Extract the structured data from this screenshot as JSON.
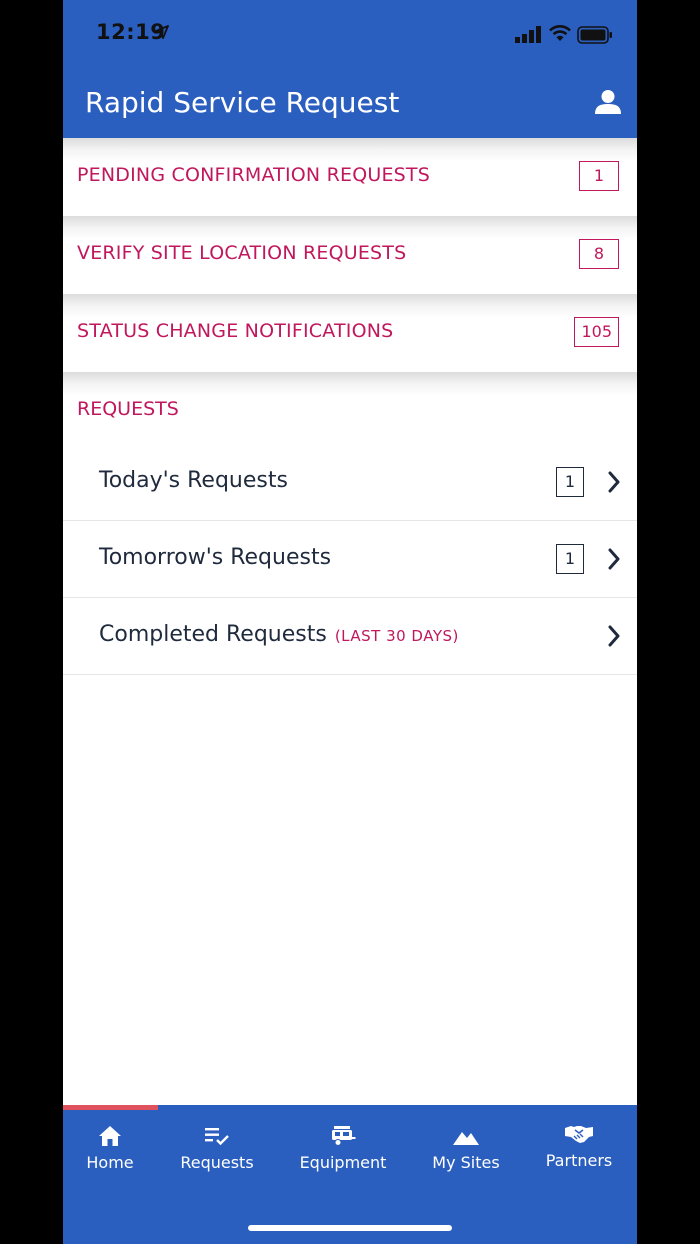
{
  "status_bar": {
    "time": "12:19"
  },
  "header": {
    "title": "Rapid Service Request"
  },
  "alerts": [
    {
      "label": "PENDING CONFIRMATION REQUESTS",
      "count": "1"
    },
    {
      "label": "VERIFY SITE LOCATION REQUESTS",
      "count": "8"
    },
    {
      "label": "STATUS CHANGE NOTIFICATIONS",
      "count": "105"
    }
  ],
  "requests_section": {
    "title": "REQUESTS",
    "items": [
      {
        "label": "Today's Requests",
        "count": "1"
      },
      {
        "label": "Tomorrow's Requests",
        "count": "1"
      },
      {
        "label": "Completed Requests",
        "sub": "(LAST 30 DAYS)"
      }
    ]
  },
  "tabs": [
    {
      "label": "Home",
      "icon": "home-icon",
      "active": true
    },
    {
      "label": "Requests",
      "icon": "requests-list-icon"
    },
    {
      "label": "Equipment",
      "icon": "rv-trailer-icon"
    },
    {
      "label": "My Sites",
      "icon": "mountain-icon"
    },
    {
      "label": "Partners",
      "icon": "handshake-icon"
    }
  ],
  "colors": {
    "brand_blue": "#2b5fbf",
    "accent_magenta": "#c0175d",
    "text_dark": "#1f2a3d",
    "active_tab_indicator": "#e0525e"
  }
}
